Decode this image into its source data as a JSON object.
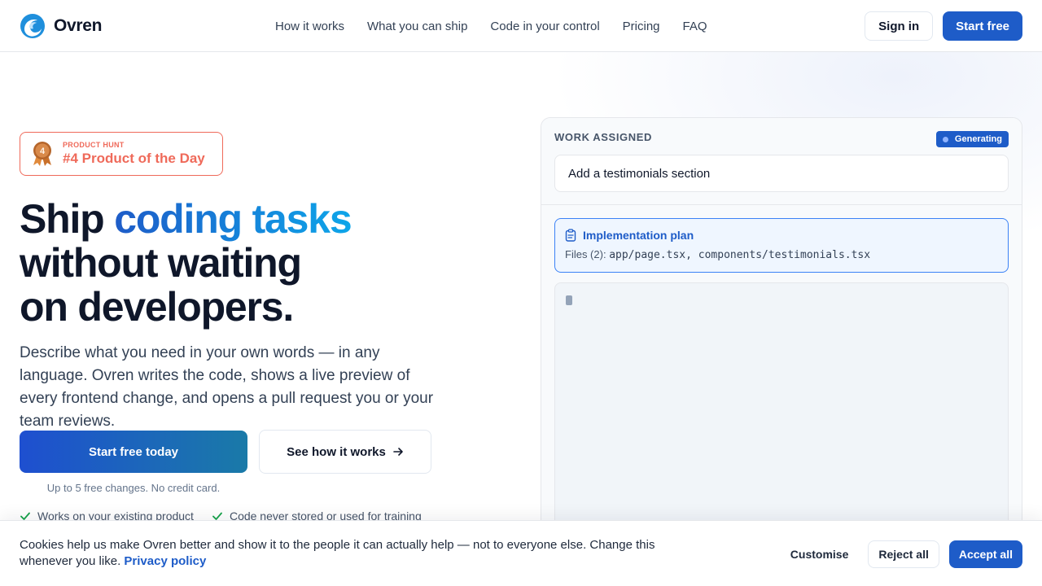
{
  "brand": {
    "name": "Ovren",
    "logo_icon": "wave-logo-icon",
    "accent": "#1e5cc8"
  },
  "nav": {
    "items": [
      {
        "label": "How it works"
      },
      {
        "label": "What you can ship"
      },
      {
        "label": "Code in your control"
      },
      {
        "label": "Pricing"
      },
      {
        "label": "FAQ"
      }
    ]
  },
  "header": {
    "sign_in": "Sign in",
    "start_free": "Start free"
  },
  "badge": {
    "kicker": "PRODUCT HUNT",
    "title": "#4 Product of the Day",
    "medal_number": "4",
    "color": "#ef6a5a"
  },
  "hero": {
    "title_start": "Ship ",
    "title_accent": "coding tasks",
    "title_line2": "without waiting",
    "title_line3": "on developers.",
    "subtitle": "Describe what you need in your own words — in any language. Ovren writes the code, shows a live preview of every frontend change, and opens a pull request you or your team reviews.",
    "cta_primary": "Start free today",
    "cta_secondary": "See how it works",
    "cta_note": "Up to 5 free changes. No credit card.",
    "checks": [
      "Works on your existing product",
      "Code never stored or used for training"
    ]
  },
  "panel": {
    "work_label": "WORK ASSIGNED",
    "status": "Generating",
    "task": "Add a testimonials section",
    "plan_title": "Implementation plan",
    "files_label": "Files (2):",
    "files": "app/page.tsx, components/testimonials.tsx"
  },
  "cookie": {
    "text": "Cookies help us make Ovren better and show it to the people it can actually help — not to everyone else. Change this whenever you like.",
    "link": "Privacy policy",
    "customise": "Customise",
    "reject": "Reject all",
    "accept": "Accept all"
  }
}
